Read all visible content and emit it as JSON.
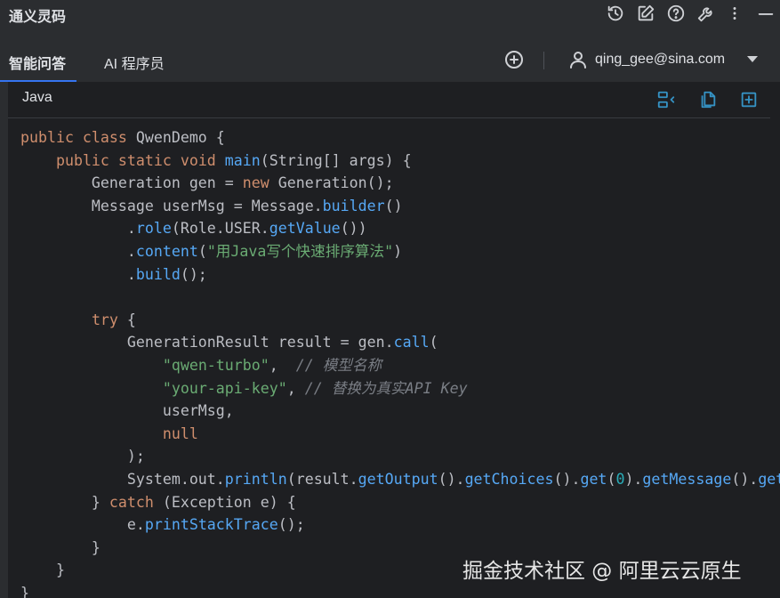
{
  "app": {
    "title": "通义灵码"
  },
  "titlebar_icons": [
    "history-icon",
    "edit-icon",
    "help-icon",
    "settings-wrench-icon",
    "more-vertical-icon",
    "minimize-icon"
  ],
  "tabs": [
    {
      "label": "智能问答",
      "active": true
    },
    {
      "label": "AI 程序员",
      "active": false
    }
  ],
  "user": {
    "email": "qing_gee@sina.com"
  },
  "code_block": {
    "language": "Java",
    "header_icons": [
      "insert-at-cursor-icon",
      "copy-icon",
      "new-file-icon"
    ],
    "lines": [
      [
        [
          "kw",
          "public class "
        ],
        [
          "",
          "QwenDemo {"
        ]
      ],
      [
        [
          "",
          "    "
        ],
        [
          "kw",
          "public static void "
        ],
        [
          "fn",
          "main"
        ],
        [
          "",
          "(String[] args) {"
        ]
      ],
      [
        [
          "",
          "        Generation gen = "
        ],
        [
          "kw",
          "new "
        ],
        [
          "",
          "Generation();"
        ]
      ],
      [
        [
          "",
          "        Message userMsg = Message."
        ],
        [
          "fn",
          "builder"
        ],
        [
          "",
          "()"
        ]
      ],
      [
        [
          "",
          "            ."
        ],
        [
          "fn",
          "role"
        ],
        [
          "",
          "(Role.USER."
        ],
        [
          "fn",
          "getValue"
        ],
        [
          "",
          "())"
        ]
      ],
      [
        [
          "",
          "            ."
        ],
        [
          "fn",
          "content"
        ],
        [
          "",
          "("
        ],
        [
          "str",
          "\"用Java写个快速排序算法\""
        ],
        [
          "",
          ")"
        ]
      ],
      [
        [
          "",
          "            ."
        ],
        [
          "fn",
          "build"
        ],
        [
          "",
          "();"
        ]
      ],
      [
        [
          "",
          ""
        ]
      ],
      [
        [
          "",
          "        "
        ],
        [
          "kw",
          "try "
        ],
        [
          "",
          "{"
        ]
      ],
      [
        [
          "",
          "            GenerationResult result = gen."
        ],
        [
          "fn",
          "call"
        ],
        [
          "",
          "("
        ]
      ],
      [
        [
          "",
          "                "
        ],
        [
          "str",
          "\"qwen-turbo\""
        ],
        [
          "",
          ",  "
        ],
        [
          "cm",
          "// 模型名称"
        ]
      ],
      [
        [
          "",
          "                "
        ],
        [
          "str",
          "\"your-api-key\""
        ],
        [
          "",
          ", "
        ],
        [
          "cm",
          "// 替换为真实API Key"
        ]
      ],
      [
        [
          "",
          "                userMsg,"
        ]
      ],
      [
        [
          "",
          "                "
        ],
        [
          "kw",
          "null"
        ]
      ],
      [
        [
          "",
          "            );"
        ]
      ],
      [
        [
          "",
          "            System.out."
        ],
        [
          "fn",
          "println"
        ],
        [
          "",
          "(result."
        ],
        [
          "fn",
          "getOutput"
        ],
        [
          "",
          "()."
        ],
        [
          "fn",
          "getChoices"
        ],
        [
          "",
          "()."
        ],
        [
          "fn",
          "get"
        ],
        [
          "",
          "("
        ],
        [
          "num",
          "0"
        ],
        [
          "",
          ")."
        ],
        [
          "fn",
          "getMessage"
        ],
        [
          "",
          "()."
        ],
        [
          "fn",
          "getContent"
        ],
        [
          "",
          "());"
        ]
      ],
      [
        [
          "",
          "        } "
        ],
        [
          "kw",
          "catch "
        ],
        [
          "",
          "(Exception e) {"
        ]
      ],
      [
        [
          "",
          "            e."
        ],
        [
          "fn",
          "printStackTrace"
        ],
        [
          "",
          "();"
        ]
      ],
      [
        [
          "",
          "        }"
        ]
      ],
      [
        [
          "",
          "    }"
        ]
      ],
      [
        [
          "",
          "}"
        ]
      ]
    ]
  },
  "watermark": "掘金技术社区 @ 阿里云云原生",
  "colors": {
    "keyword": "#cf8e6d",
    "function": "#56a8f5",
    "string": "#6aab73",
    "comment": "#7a7e85",
    "number": "#2aacb8",
    "accent": "#3574f0",
    "header_icon": "#3592c4"
  }
}
